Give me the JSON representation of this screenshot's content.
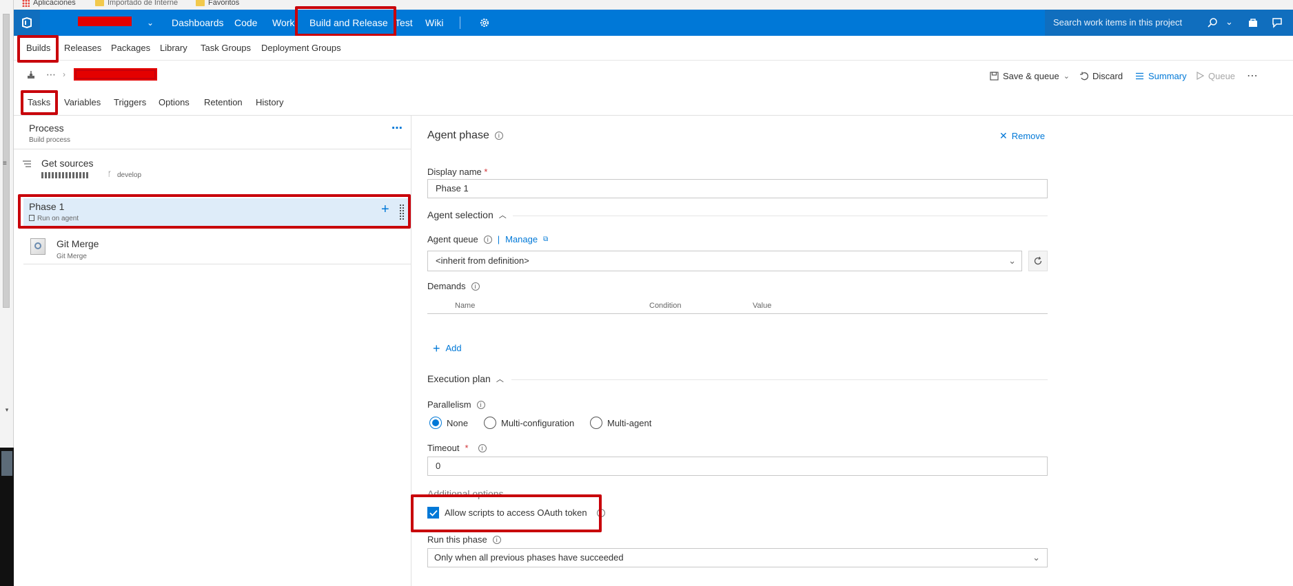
{
  "bookmarks": {
    "items": [
      "Aplicaciones",
      "Importado de Interne",
      "Favoritos"
    ]
  },
  "topnav": {
    "items": [
      "Dashboards",
      "Code",
      "Work",
      "Build and Release",
      "Test",
      "Wiki"
    ],
    "search_placeholder": "Search work items in this project"
  },
  "subnav": {
    "items": [
      "Builds",
      "Releases",
      "Packages",
      "Library",
      "Task Groups",
      "Deployment Groups"
    ]
  },
  "toolbar": {
    "save_queue": "Save & queue",
    "discard": "Discard",
    "summary": "Summary",
    "queue": "Queue"
  },
  "tabs": [
    "Tasks",
    "Variables",
    "Triggers",
    "Options",
    "Retention",
    "History"
  ],
  "left": {
    "process_title": "Process",
    "process_sub": "Build process",
    "get_sources_title": "Get sources",
    "get_sources_branch": "develop",
    "phase_title": "Phase 1",
    "phase_sub": "Run on agent",
    "task_title": "Git Merge",
    "task_sub": "Git Merge"
  },
  "right": {
    "header": "Agent phase",
    "remove": "Remove",
    "display_name_label": "Display name",
    "display_name_value": "Phase 1",
    "agent_selection": "Agent selection",
    "agent_queue_label": "Agent queue",
    "manage": "Manage",
    "agent_queue_value": "<inherit from definition>",
    "demands_label": "Demands",
    "demands_columns": [
      "Name",
      "Condition",
      "Value"
    ],
    "add": "Add",
    "execution_plan": "Execution plan",
    "parallelism_label": "Parallelism",
    "parallelism_options": [
      "None",
      "Multi-configuration",
      "Multi-agent"
    ],
    "parallelism_selected": "None",
    "timeout_label": "Timeout",
    "timeout_value": "0",
    "additional_options": "Additional options",
    "oauth_label": "Allow scripts to access OAuth token",
    "oauth_checked": true,
    "run_phase_label": "Run this phase",
    "run_phase_value": "Only when all previous phases have succeeded"
  },
  "colors": {
    "nav_blue": "#0078d7",
    "highlight_red": "#c8000a",
    "selected_row": "#deecf9"
  }
}
